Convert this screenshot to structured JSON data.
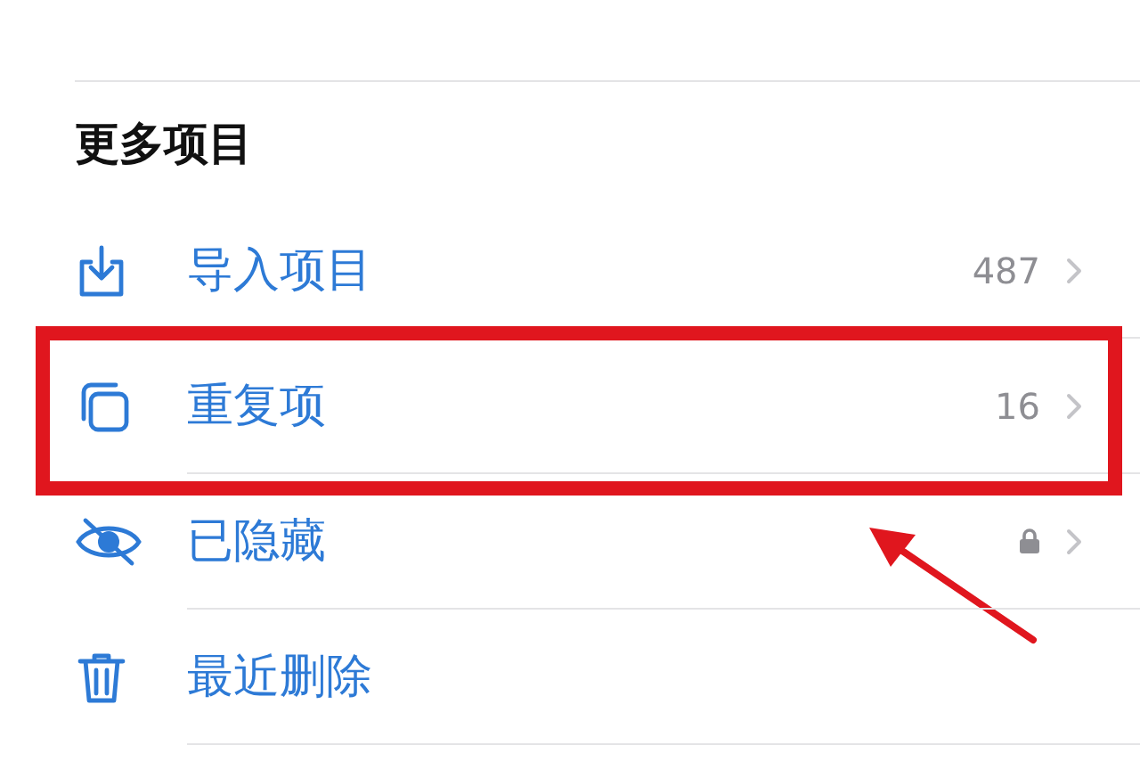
{
  "section": {
    "title": "更多项目"
  },
  "items": [
    {
      "label": "导入项目",
      "kind": "count",
      "count": "487",
      "highlighted": false
    },
    {
      "label": "重复项",
      "kind": "count",
      "count": "16",
      "highlighted": true
    },
    {
      "label": "已隐藏",
      "kind": "locked",
      "highlighted": false
    },
    {
      "label": "最近删除",
      "kind": "plain",
      "highlighted": false
    }
  ]
}
